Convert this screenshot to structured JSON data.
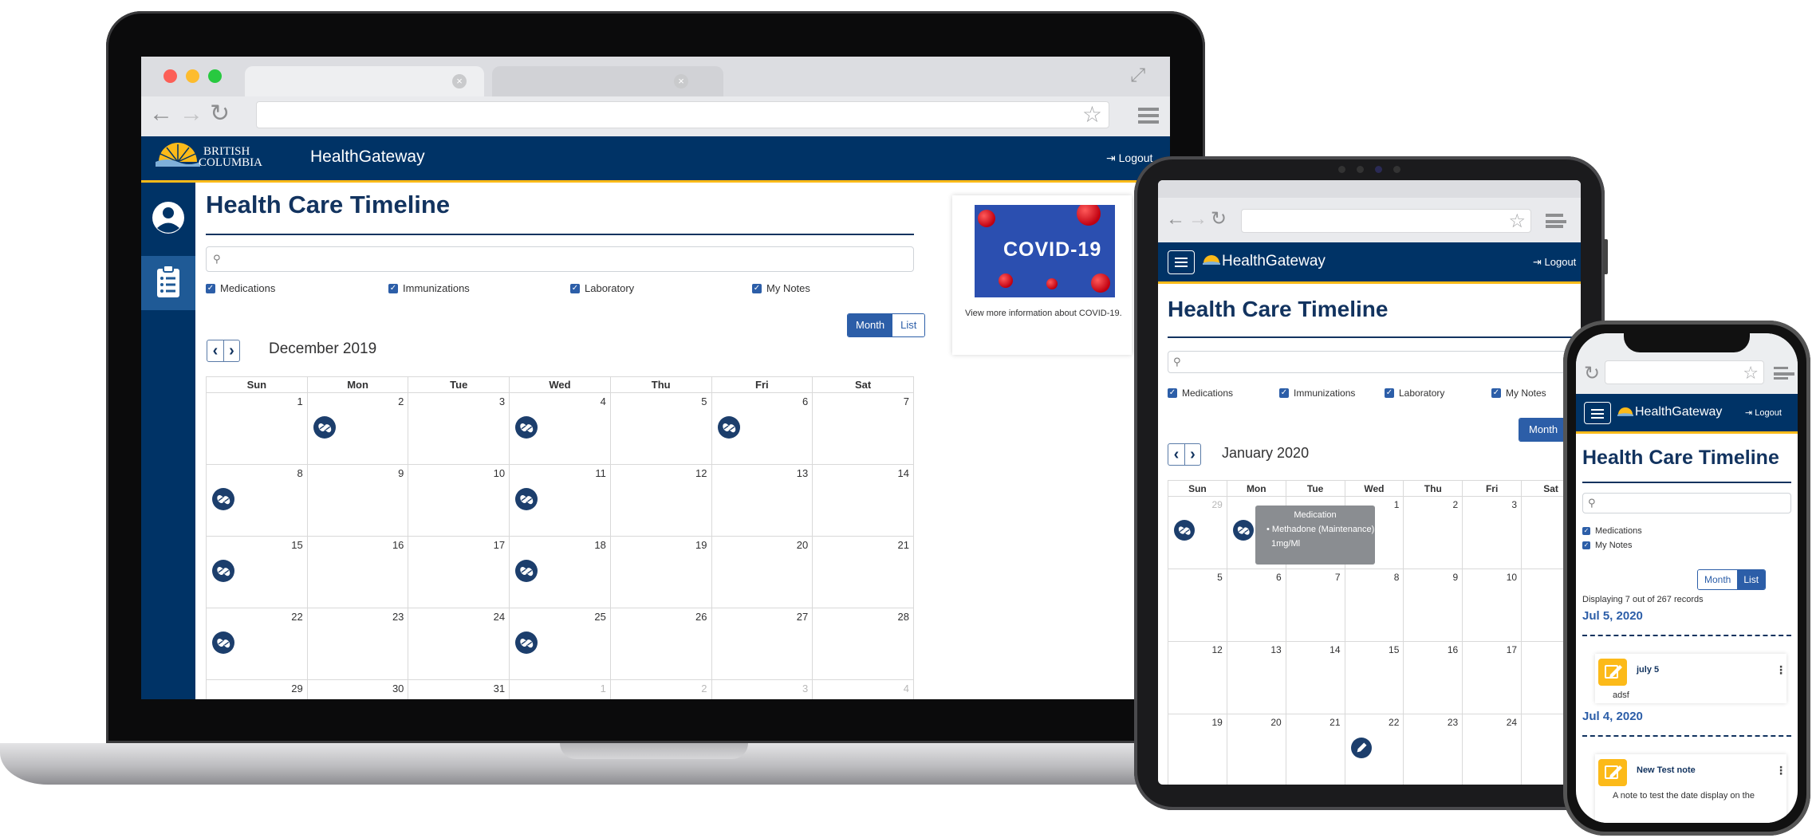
{
  "brand": "HealthGateway",
  "logout_label": "Logout",
  "bc_logo_text": [
    "BRITISH",
    "COLUMBIA"
  ],
  "page_title": "Health Care Timeline",
  "filters": [
    "Medications",
    "Immunizations",
    "Laboratory",
    "My Notes"
  ],
  "view_toggle": {
    "month": "Month",
    "list": "List"
  },
  "pager": {
    "prev": "‹",
    "next": "›"
  },
  "weekdays": [
    "Sun",
    "Mon",
    "Tue",
    "Wed",
    "Thu",
    "Fri",
    "Sat"
  ],
  "laptop": {
    "month_label": "December 2019",
    "weeks": [
      [
        {
          "d": "1"
        },
        {
          "d": "2",
          "med": true
        },
        {
          "d": "3"
        },
        {
          "d": "4",
          "med": true
        },
        {
          "d": "5"
        },
        {
          "d": "6",
          "med": true
        },
        {
          "d": "7"
        }
      ],
      [
        {
          "d": "8",
          "med": true
        },
        {
          "d": "9"
        },
        {
          "d": "10"
        },
        {
          "d": "11",
          "med": true
        },
        {
          "d": "12"
        },
        {
          "d": "13"
        },
        {
          "d": "14"
        }
      ],
      [
        {
          "d": "15",
          "med": true
        },
        {
          "d": "16"
        },
        {
          "d": "17"
        },
        {
          "d": "18",
          "med": true
        },
        {
          "d": "19"
        },
        {
          "d": "20"
        },
        {
          "d": "21"
        }
      ],
      [
        {
          "d": "22",
          "med": true
        },
        {
          "d": "23"
        },
        {
          "d": "24"
        },
        {
          "d": "25",
          "med": true
        },
        {
          "d": "26"
        },
        {
          "d": "27"
        },
        {
          "d": "28"
        }
      ],
      [
        {
          "d": "29"
        },
        {
          "d": "30"
        },
        {
          "d": "31"
        },
        {
          "d": "1",
          "muted": true
        },
        {
          "d": "2",
          "muted": true
        },
        {
          "d": "3",
          "muted": true
        },
        {
          "d": "4",
          "muted": true
        }
      ]
    ],
    "card": {
      "image_text": "COVID-19",
      "caption": "View more information about COVID-19."
    }
  },
  "tablet": {
    "month_label": "January 2020",
    "month_button": "Month",
    "weeks": [
      [
        {
          "d": "29",
          "muted": true,
          "med": true
        },
        {
          "d": "",
          "med": true
        },
        {
          "d": ""
        },
        {
          "d": "1"
        },
        {
          "d": "2"
        },
        {
          "d": "3"
        },
        {
          "d": ""
        }
      ],
      [
        {
          "d": "5"
        },
        {
          "d": "6"
        },
        {
          "d": "7"
        },
        {
          "d": "8"
        },
        {
          "d": "9"
        },
        {
          "d": "10"
        },
        {
          "d": ""
        }
      ],
      [
        {
          "d": "12"
        },
        {
          "d": "13"
        },
        {
          "d": "14"
        },
        {
          "d": "15"
        },
        {
          "d": "16"
        },
        {
          "d": "17"
        },
        {
          "d": ""
        }
      ],
      [
        {
          "d": "19"
        },
        {
          "d": "20"
        },
        {
          "d": "21"
        },
        {
          "d": "22",
          "note": true
        },
        {
          "d": "23"
        },
        {
          "d": "24"
        },
        {
          "d": ""
        }
      ]
    ],
    "tooltip": {
      "title": "Medication",
      "item": "Methadone (Maintenance)",
      "dose": "1mg/Ml"
    }
  },
  "phone": {
    "filters": [
      "Medications",
      "My Notes"
    ],
    "records_text": "Displaying 7 out of 267 records",
    "entries": [
      {
        "date": "Jul 5, 2020",
        "title": "july 5",
        "body": "adsf"
      },
      {
        "date": "Jul 4, 2020",
        "title": "New Test note",
        "body": "A note to test the date display on the"
      }
    ]
  },
  "colors": {
    "navy": "#003366",
    "gold": "#fcba19",
    "primary": "#2c5ea8",
    "title": "#12335f"
  }
}
